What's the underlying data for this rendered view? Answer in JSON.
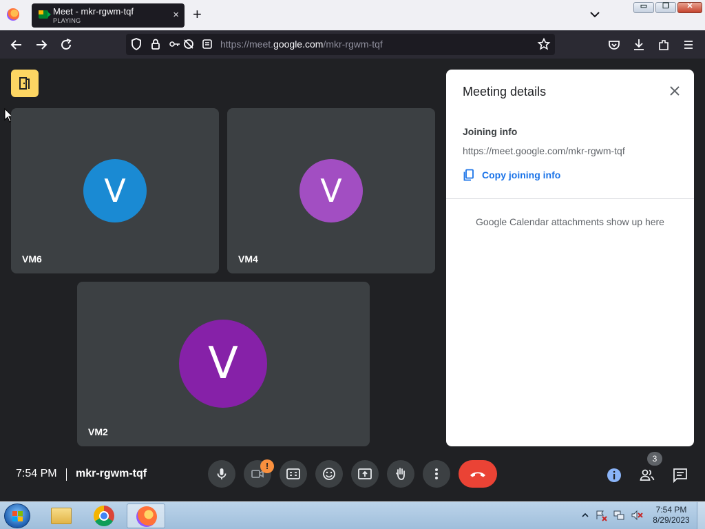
{
  "browser": {
    "tab": {
      "title": "Meet - mkr-rgwm-tqf",
      "subtitle": "PLAYING",
      "close": "×"
    },
    "new_tab": "+",
    "url": {
      "prefix": "https://meet.",
      "domain": "google.com",
      "path": "/mkr-rgwm-tqf"
    },
    "window_buttons": {
      "minimize": "▭",
      "restore": "❐",
      "close": "✕"
    }
  },
  "meeting": {
    "participants": [
      {
        "initial": "V",
        "name": "VM6",
        "color": "#1a8ad3"
      },
      {
        "initial": "V",
        "name": "VM4",
        "color": "#a24ec2"
      },
      {
        "initial": "V",
        "name": "VM2",
        "color": "#8621a8"
      }
    ]
  },
  "panel": {
    "title": "Meeting details",
    "joining_label": "Joining info",
    "joining_url": "https://meet.google.com/mkr-rgwm-tqf",
    "copy_label": "Copy joining info",
    "attachments_note": "Google Calendar attachments show up here"
  },
  "bottom_bar": {
    "time": "7:54 PM",
    "meeting_code": "mkr-rgwm-tqf",
    "camera_warning": "!",
    "people_count": "3"
  },
  "taskbar": {
    "time": "7:54 PM",
    "date": "8/29/2023"
  },
  "colors": {
    "end_call": "#ea4335",
    "accent": "#1a73e8",
    "warning": "#fa903e",
    "activities": "#fdd663"
  }
}
